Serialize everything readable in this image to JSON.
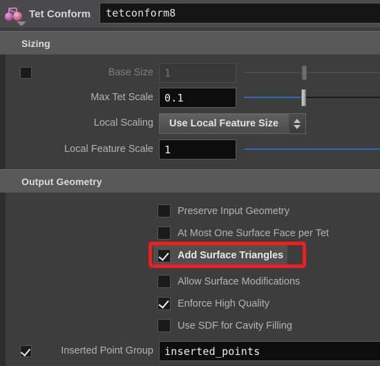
{
  "titlebar": {
    "node_icon": "tetrahedron-mesh-icon",
    "title": "Tet Conform",
    "name_value": "tetconform8",
    "collapse_caret": "caret-down-icon"
  },
  "sections": [
    {
      "id": "sizing",
      "label": "Sizing"
    },
    {
      "id": "output",
      "label": "Output Geometry"
    }
  ],
  "sizing": {
    "base_size": {
      "label": "Base Size",
      "value": "1",
      "enabled": false,
      "toggle_checked": false,
      "slider_percent": 43
    },
    "max_tet_scale": {
      "label": "Max Tet Scale",
      "value": "0.1",
      "enabled": true,
      "slider_percent": 44
    },
    "local_scaling": {
      "label": "Local Scaling",
      "selected": "Use Local Feature Size"
    },
    "local_feature_scale": {
      "label": "Local Feature Scale",
      "value": "1",
      "slider_percent": 100
    }
  },
  "output_geometry": {
    "checkboxes": [
      {
        "label": "Preserve Input Geometry",
        "checked": false,
        "highlighted": false
      },
      {
        "label": "At Most One Surface Face per Tet",
        "checked": false,
        "highlighted": false
      },
      {
        "label": "Add Surface Triangles",
        "checked": true,
        "highlighted": true
      },
      {
        "label": "Allow Surface Modifications",
        "checked": false,
        "highlighted": false
      },
      {
        "label": "Enforce High Quality",
        "checked": true,
        "highlighted": false
      },
      {
        "label": "Use SDF for Cavity Filling",
        "checked": false,
        "highlighted": false
      }
    ],
    "inserted_point_group": {
      "label": "Inserted Point Group",
      "checked": true,
      "value": "inserted_points"
    }
  },
  "annotation": {
    "highlight_color": "#f01f1f",
    "target": "Add Surface Triangles"
  },
  "colors": {
    "panel_bg": "#3d3d3d",
    "section_header_bg": "#585858",
    "titlebar_bg": "#4a4a4d",
    "field_bg": "#0d0d0d",
    "slider_blue": "#2a6ebb",
    "text": "#b4b4b4"
  }
}
